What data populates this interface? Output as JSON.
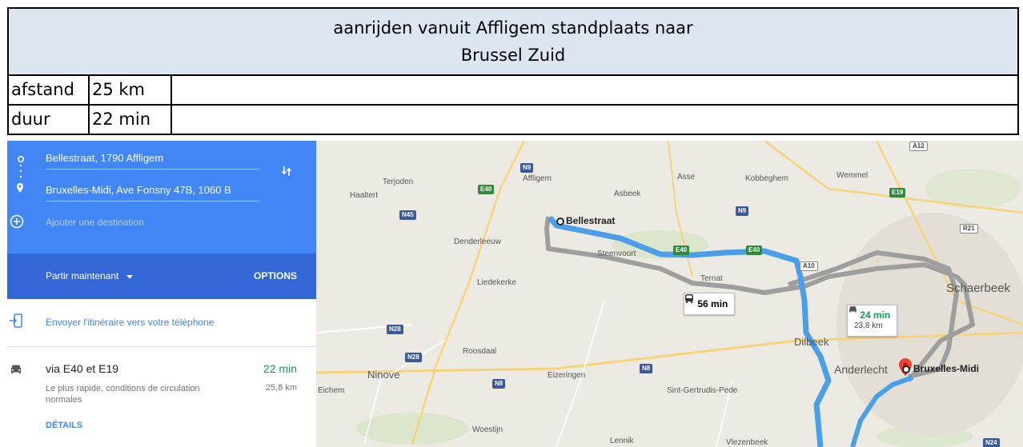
{
  "sheet": {
    "title_line1": "aanrijden vanuit Affligem standplaats naar",
    "title_line2": "Brussel Zuid",
    "rows": [
      {
        "label": "afstand",
        "value": "25 km"
      },
      {
        "label": "duur",
        "value": "22 min"
      }
    ]
  },
  "panel": {
    "origin": "Bellestraat, 1790 Affligem",
    "destination": "Bruxelles-Midi, Ave Fonsny 47B, 1060 B",
    "add_destination_placeholder": "Ajouter une destination",
    "depart_label": "Partir maintenant",
    "options_label": "OPTIONS",
    "send_label": "Envoyer l'itinéraire vers votre téléphone",
    "route": {
      "via": "via E40 et E19",
      "time": "22 min",
      "description": "Le plus rapide, conditions de circulation normales",
      "distance": "25,8 km",
      "details_label": "DÉTAILS"
    },
    "icons": [
      "origin-dot-icon",
      "destination-pin-icon",
      "add-destination-icon",
      "swap-icon",
      "dropdown-caret-icon",
      "send-to-phone-icon",
      "car-icon"
    ]
  },
  "map": {
    "colors": {
      "selected_route": "#4a9fe8",
      "alt_route": "#9e9e9e",
      "pin": "#ea4335",
      "car_time": "#0f9d58"
    },
    "places": [
      "Terjoden",
      "Affligem",
      "Asse",
      "Kobbeghem",
      "Wemmel",
      "Haaltert",
      "Asbeek",
      "Denderleeuw",
      "Steenvoort",
      "Liedekerke",
      "Ternat",
      "Schaerbeek",
      "Dilbeek",
      "Roosdaal",
      "Ninove",
      "Eizeringen",
      "Anderlecht",
      "Sint-Gertrudis-Pede",
      "Eichem",
      "Woestijn",
      "Lennik",
      "Vlezenbeek"
    ],
    "shields": [
      "N9",
      "E40",
      "N45",
      "N9",
      "E19",
      "A12",
      "R21",
      "E40",
      "E40",
      "A10",
      "N28",
      "N28",
      "N8",
      "N8",
      "N24"
    ],
    "origin_label": "Bellestraat",
    "destination_label": "Bruxelles-Midi",
    "transit_time": "56 min",
    "car_time": "24 min",
    "car_distance": "23,8 km"
  }
}
